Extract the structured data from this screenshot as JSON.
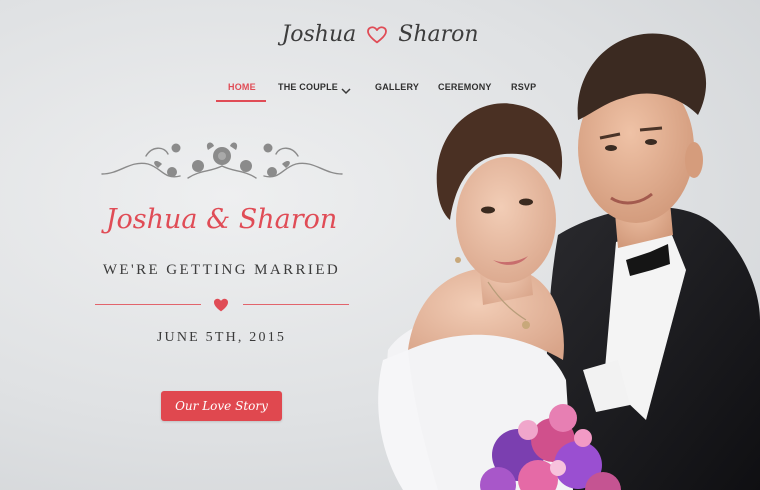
{
  "header": {
    "brand_left": "Joshua",
    "brand_right": "Sharon"
  },
  "nav": {
    "items": [
      {
        "label": "HOME",
        "active": true
      },
      {
        "label": "THE COUPLE",
        "active": false
      },
      {
        "label": "GALLERY",
        "active": false
      },
      {
        "label": "CEREMONY",
        "active": false
      },
      {
        "label": "RSVP",
        "active": false
      }
    ]
  },
  "hero": {
    "title": "Joshua & Sharon",
    "tagline": "WE'RE GETTING MARRIED",
    "date": "JUNE 5TH, 2015",
    "cta_label": "Our Love Story"
  },
  "colors": {
    "accent": "#e04c56",
    "text": "#3b3b3b",
    "background": "#dfe1e3"
  },
  "icons": {
    "brand_heart": "heart-outline-icon",
    "nav_dropdown": "chevron-down-icon",
    "divider_heart": "heart-icon",
    "ornament": "floral-ornament-icon"
  }
}
